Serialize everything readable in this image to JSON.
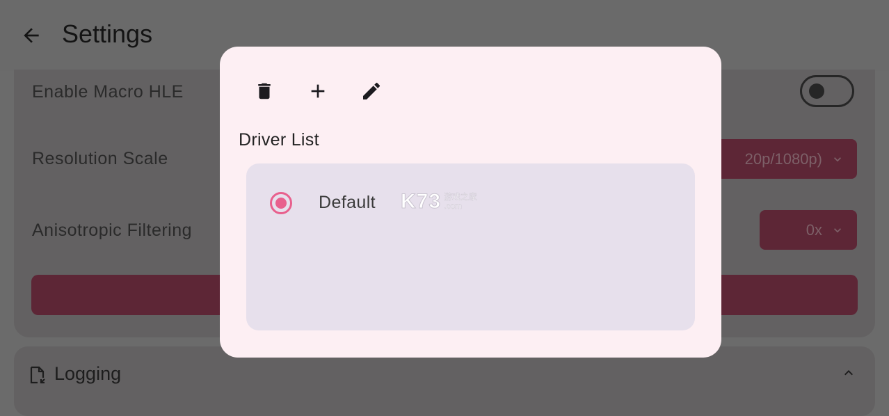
{
  "topbar": {
    "title": "Settings",
    "back_icon": "arrow-left-icon"
  },
  "settings": {
    "rows": [
      {
        "label": "Enable Macro HLE"
      },
      {
        "label": "Resolution Scale",
        "value": "20p/1080p)"
      },
      {
        "label": "Anisotropic Filtering",
        "value": "0x"
      }
    ],
    "logging_label": "Logging"
  },
  "dialog": {
    "toolbar_icons": [
      "delete-icon",
      "add-icon",
      "edit-icon"
    ],
    "title": "Driver List",
    "items": [
      {
        "label": "Default",
        "selected": true
      }
    ],
    "watermark": {
      "main": "K73",
      "sub1": "游戏之家",
      "sub2": ".com"
    }
  },
  "colors": {
    "scrim": "#6b6b6b",
    "dialog_bg": "#fdeff3",
    "list_bg": "#e7e0ec",
    "accent": "#e8608d",
    "button_dim": "#5d2636"
  }
}
